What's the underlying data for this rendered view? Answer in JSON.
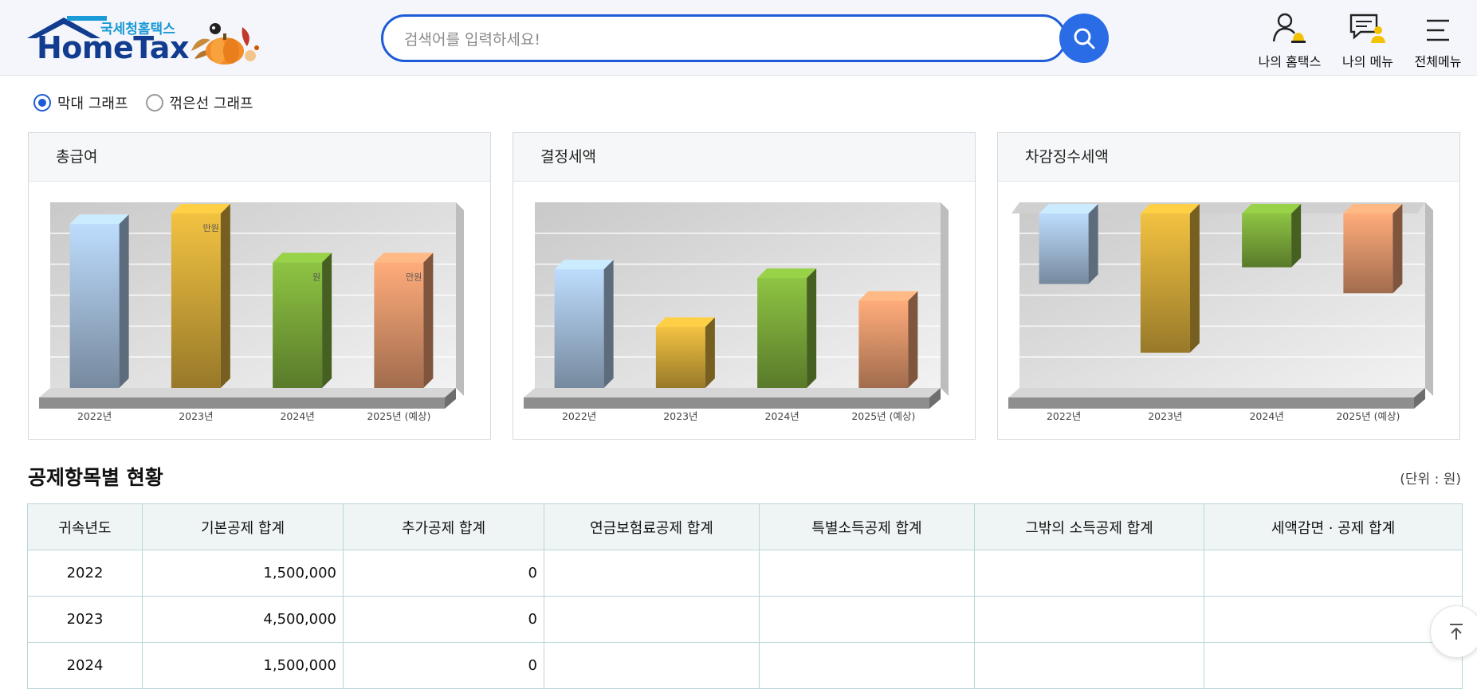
{
  "header": {
    "logo_sub": "국세청홈택스",
    "logo_main": "HomeTax",
    "search_placeholder": "검색어를 입력하세요!",
    "nav": [
      {
        "label": "나의 홈택스",
        "icon": "user-bell-icon"
      },
      {
        "label": "나의 메뉴",
        "icon": "menu-user-icon"
      },
      {
        "label": "전체메뉴",
        "icon": "hamburger-icon"
      }
    ]
  },
  "view_toggle": {
    "options": [
      "막대 그래프",
      "꺾은선 그래프"
    ],
    "selected": "막대 그래프"
  },
  "charts": {
    "titles": [
      "총급여",
      "결정세액",
      "차감징수세액"
    ],
    "categories": [
      "2022년",
      "2023년",
      "2024년",
      "2025년 (예상)"
    ],
    "colors": [
      "#a9c4e2",
      "#d8ad3a",
      "#7faf3c",
      "#e69a6e"
    ],
    "value_label_suffix": "만원"
  },
  "chart_data": [
    {
      "type": "bar",
      "title": "총급여",
      "categories": [
        "2022년",
        "2023년",
        "2024년",
        "2025년 (예상)"
      ],
      "values": [
        0.94,
        1.0,
        0.72,
        0.72
      ],
      "value_labels": [
        "",
        "만원",
        "원",
        "만원"
      ],
      "grid": true
    },
    {
      "type": "bar",
      "title": "결정세액",
      "categories": [
        "2022년",
        "2023년",
        "2024년",
        "2025년 (예상)"
      ],
      "values": [
        0.68,
        0.35,
        0.63,
        0.5
      ],
      "value_labels": [
        "",
        "",
        "",
        ""
      ],
      "grid": true
    },
    {
      "type": "bar",
      "title": "차감징수세액",
      "categories": [
        "2022년",
        "2023년",
        "2024년",
        "2025년 (예상)"
      ],
      "values": [
        -0.38,
        -0.75,
        -0.29,
        -0.43
      ],
      "value_labels": [
        "",
        "",
        "",
        ""
      ],
      "grid": true
    }
  ],
  "deductions": {
    "title": "공제항목별 현황",
    "unit": "(단위 : 원)",
    "columns": [
      "귀속년도",
      "기본공제 합계",
      "추가공제 합계",
      "연금보험료공제 합계",
      "특별소득공제 합계",
      "그밖의 소득공제 합계",
      "세액감면 · 공제 합계"
    ],
    "rows": [
      [
        "2022",
        "1,500,000",
        "0",
        "",
        "",
        "",
        ""
      ],
      [
        "2023",
        "4,500,000",
        "0",
        "",
        "",
        "",
        ""
      ],
      [
        "2024",
        "1,500,000",
        "0",
        "",
        "",
        "",
        ""
      ]
    ]
  }
}
